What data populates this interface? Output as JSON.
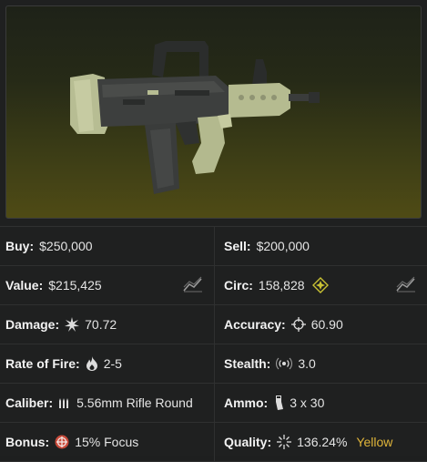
{
  "item": {
    "image_name": "assault-rifle-image"
  },
  "stats": {
    "buy": {
      "label": "Buy:",
      "value": "$250,000"
    },
    "sell": {
      "label": "Sell:",
      "value": "$200,000"
    },
    "value": {
      "label": "Value:",
      "value": "$215,425"
    },
    "circ": {
      "label": "Circ:",
      "value": "158,828"
    },
    "damage": {
      "label": "Damage:",
      "value": "70.72"
    },
    "accuracy": {
      "label": "Accuracy:",
      "value": "60.90"
    },
    "rate_of_fire": {
      "label": "Rate of Fire:",
      "value": "2-5"
    },
    "stealth": {
      "label": "Stealth:",
      "value": "3.0"
    },
    "caliber": {
      "label": "Caliber:",
      "value": "5.56mm Rifle Round"
    },
    "ammo": {
      "label": "Ammo:",
      "value": "3 x 30"
    },
    "bonus": {
      "label": "Bonus:",
      "value": "15% Focus"
    },
    "quality": {
      "label": "Quality:",
      "value": "136.24%",
      "tier": "Yellow"
    }
  },
  "icons": {
    "value_trend": "trend-chart-icon",
    "circ_trend": "trend-chart-icon",
    "circ": "diamond-star-icon",
    "damage": "burst-icon",
    "accuracy": "crosshair-icon",
    "rate_of_fire": "flame-icon",
    "stealth": "radar-wave-icon",
    "caliber": "bullets-icon",
    "ammo": "magazine-icon",
    "bonus": "bonus-badge-icon",
    "quality": "sparkle-icon"
  },
  "colors": {
    "quality_tier": "#e0b53a",
    "circ_icon": "#c9c233",
    "bonus_icon": "#c94b3b"
  }
}
